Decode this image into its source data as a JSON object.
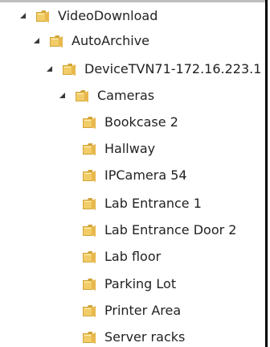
{
  "tree": {
    "root": {
      "label": "VideoDownload"
    },
    "archive": {
      "label": "AutoArchive"
    },
    "device": {
      "label": "DeviceTVN71-172.16.223.1"
    },
    "cameras": {
      "label": "Cameras"
    },
    "items": [
      {
        "label": "Bookcase 2"
      },
      {
        "label": "Hallway"
      },
      {
        "label": "IPCamera 54"
      },
      {
        "label": "Lab Entrance 1"
      },
      {
        "label": "Lab Entrance Door 2"
      },
      {
        "label": "Lab floor"
      },
      {
        "label": "Parking Lot"
      },
      {
        "label": "Printer Area"
      },
      {
        "label": "Server racks"
      }
    ]
  },
  "colors": {
    "folder_fill": "#f2cc67",
    "folder_shadow": "#d2a53a",
    "folder_highlight": "#fff0b8",
    "text": "#222222"
  }
}
